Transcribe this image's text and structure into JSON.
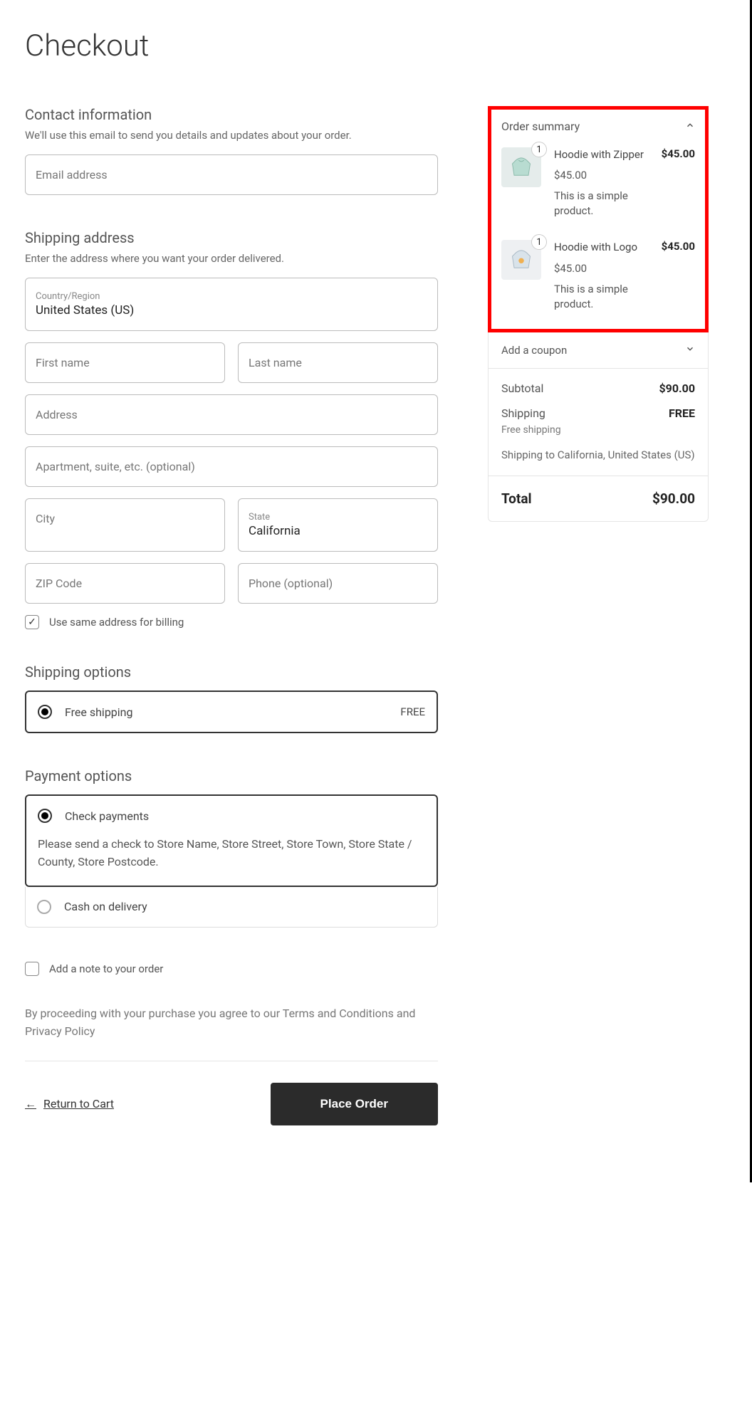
{
  "page_title": "Checkout",
  "contact": {
    "heading": "Contact information",
    "desc": "We'll use this email to send you details and updates about your order.",
    "email_label": "Email address"
  },
  "shipping": {
    "heading": "Shipping address",
    "desc": "Enter the address where you want your order delivered.",
    "country_label": "Country/Region",
    "country_value": "United States (US)",
    "first_name_label": "First name",
    "last_name_label": "Last name",
    "address_label": "Address",
    "apt_label": "Apartment, suite, etc. (optional)",
    "city_label": "City",
    "state_label": "State",
    "state_value": "California",
    "zip_label": "ZIP Code",
    "phone_label": "Phone (optional)",
    "same_billing_label": "Use same address for billing"
  },
  "shipping_options": {
    "heading": "Shipping options",
    "option_label": "Free shipping",
    "option_price": "FREE"
  },
  "payment": {
    "heading": "Payment options",
    "check_label": "Check payments",
    "check_desc": "Please send a check to Store Name, Store Street, Store Town, Store State / County, Store Postcode.",
    "cod_label": "Cash on delivery"
  },
  "note_label": "Add a note to your order",
  "terms_text": "By proceeding with your purchase you agree to our Terms and Conditions and Privacy Policy",
  "return_link": "Return to Cart",
  "place_order_label": "Place Order",
  "order_summary": {
    "heading": "Order summary",
    "items": [
      {
        "qty": "1",
        "name": "Hoodie with Zipper",
        "unit_price": "$45.00",
        "line_total": "$45.00",
        "desc": "This is a simple product."
      },
      {
        "qty": "1",
        "name": "Hoodie with Logo",
        "unit_price": "$45.00",
        "line_total": "$45.00",
        "desc": "This is a simple product."
      }
    ],
    "coupon_label": "Add a coupon",
    "subtotal_label": "Subtotal",
    "subtotal_value": "$90.00",
    "shipping_label": "Shipping",
    "shipping_value": "FREE",
    "shipping_note": "Free shipping",
    "shipping_to": "Shipping to California, United States (US)",
    "total_label": "Total",
    "total_value": "$90.00"
  }
}
